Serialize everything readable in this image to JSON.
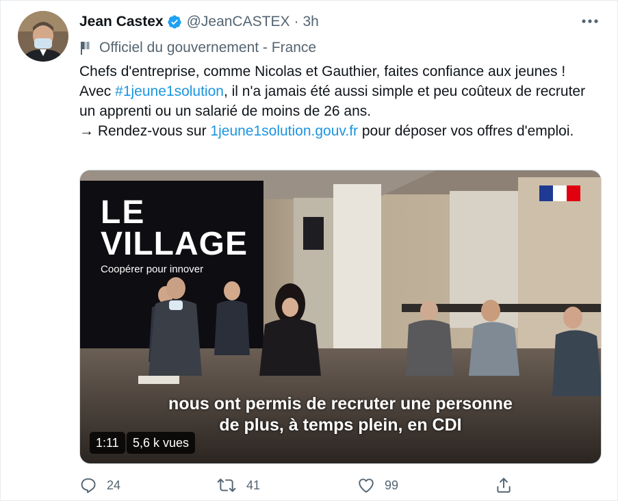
{
  "author": {
    "name": "Jean Castex",
    "handle": "@JeanCASTEX",
    "separator": "·",
    "time": "3h",
    "verified": true,
    "label": "Officiel du gouvernement - France"
  },
  "tweet": {
    "line1": "Chefs d'entreprise, comme Nicolas et Gauthier, faites confiance aux jeunes !",
    "line2_before": "Avec ",
    "hashtag": "#1jeune1solution",
    "line2_after": ", il n'a jamais été aussi simple et peu coûteux de recruter un apprenti ou un salarié de moins de 26 ans.",
    "line3_before": "→ Rendez-vous sur ",
    "link": "1jeune1solution.gouv.fr",
    "line3_after": " pour déposer vos offres d'emploi."
  },
  "video": {
    "sign_line1": "LE",
    "sign_line2": "VILLAGE",
    "sign_tagline": "Coopérer pour innover",
    "subtitle_line1": "nous ont permis de recruter une personne",
    "subtitle_line2": "de plus, à temps plein, en CDI",
    "duration": "1:11",
    "views": "5,6 k vues"
  },
  "actions": {
    "replies": "24",
    "retweets": "41",
    "likes": "99"
  },
  "colors": {
    "link": "#1b95e0",
    "verified": "#1da1f2",
    "secondary_text": "#536471"
  },
  "icons": [
    "verified-badge-icon",
    "more-icon",
    "government-flag-icon",
    "reply-icon",
    "retweet-icon",
    "like-icon",
    "share-icon",
    "french-flag-logo-icon"
  ]
}
